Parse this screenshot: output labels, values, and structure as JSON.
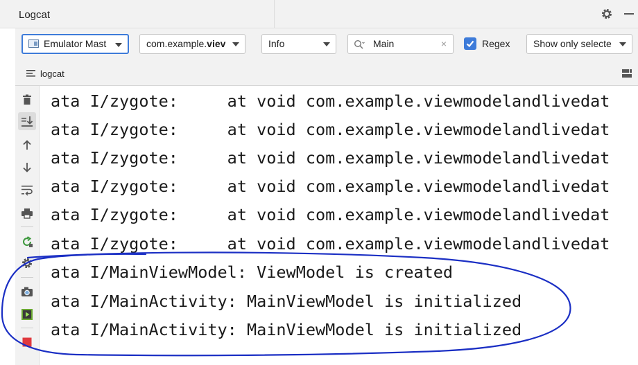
{
  "window": {
    "title": "Logcat",
    "title_actions": [
      {
        "name": "settings",
        "icon": "gear-icon"
      },
      {
        "name": "hide",
        "icon": "minimize-icon"
      }
    ]
  },
  "toolbar": {
    "device": {
      "value": "Emulator Mast",
      "icon": "device-icon"
    },
    "app": {
      "value_prefix": "com.example.",
      "value_bold": "viev"
    },
    "level": {
      "value": "Info"
    },
    "search": {
      "value": "Main",
      "icon": "search-icon",
      "clear": "×"
    },
    "regex": {
      "label": "Regex",
      "checked": true
    },
    "filter": {
      "value": "Show only selecte"
    }
  },
  "tabs": [
    {
      "label": "logcat",
      "icon": "lines-icon",
      "active": true
    }
  ],
  "sidebar": {
    "buttons": [
      {
        "name": "clear-logcat",
        "icon": "trash-icon"
      },
      {
        "name": "scroll-to-end",
        "icon": "scroll-end-icon",
        "active": true
      },
      {
        "name": "up-the-stack",
        "icon": "arrow-up-icon"
      },
      {
        "name": "down-the-stack",
        "icon": "arrow-down-icon"
      },
      {
        "name": "soft-wraps",
        "icon": "wrap-icon"
      },
      {
        "name": "print",
        "icon": "printer-icon"
      },
      {
        "name": "restart",
        "icon": "restart-icon"
      },
      {
        "name": "settings",
        "icon": "gear-icon"
      },
      {
        "name": "screen-capture",
        "icon": "camera-icon"
      },
      {
        "name": "screen-record",
        "icon": "record-icon"
      },
      {
        "name": "terminate",
        "icon": "stop-icon"
      }
    ]
  },
  "log": {
    "lines": [
      "ata I/zygote:     at void com.example.viewmodelandlivedat",
      "ata I/zygote:     at void com.example.viewmodelandlivedat",
      "ata I/zygote:     at void com.example.viewmodelandlivedat",
      "ata I/zygote:     at void com.example.viewmodelandlivedat",
      "ata I/zygote:     at void com.example.viewmodelandlivedat",
      "ata I/zygote:     at void com.example.viewmodelandlivedat",
      "ata I/MainViewModel: ViewModel is created",
      "ata I/MainActivity: MainViewModel is initialized",
      "ata I/MainActivity: MainViewModel is initialized"
    ]
  },
  "colors": {
    "accent": "#3d7bd9",
    "annotation": "#1b2fc4",
    "panel_bg": "#f2f2f2",
    "stop": "#e0393e",
    "record": "#6aa832"
  }
}
